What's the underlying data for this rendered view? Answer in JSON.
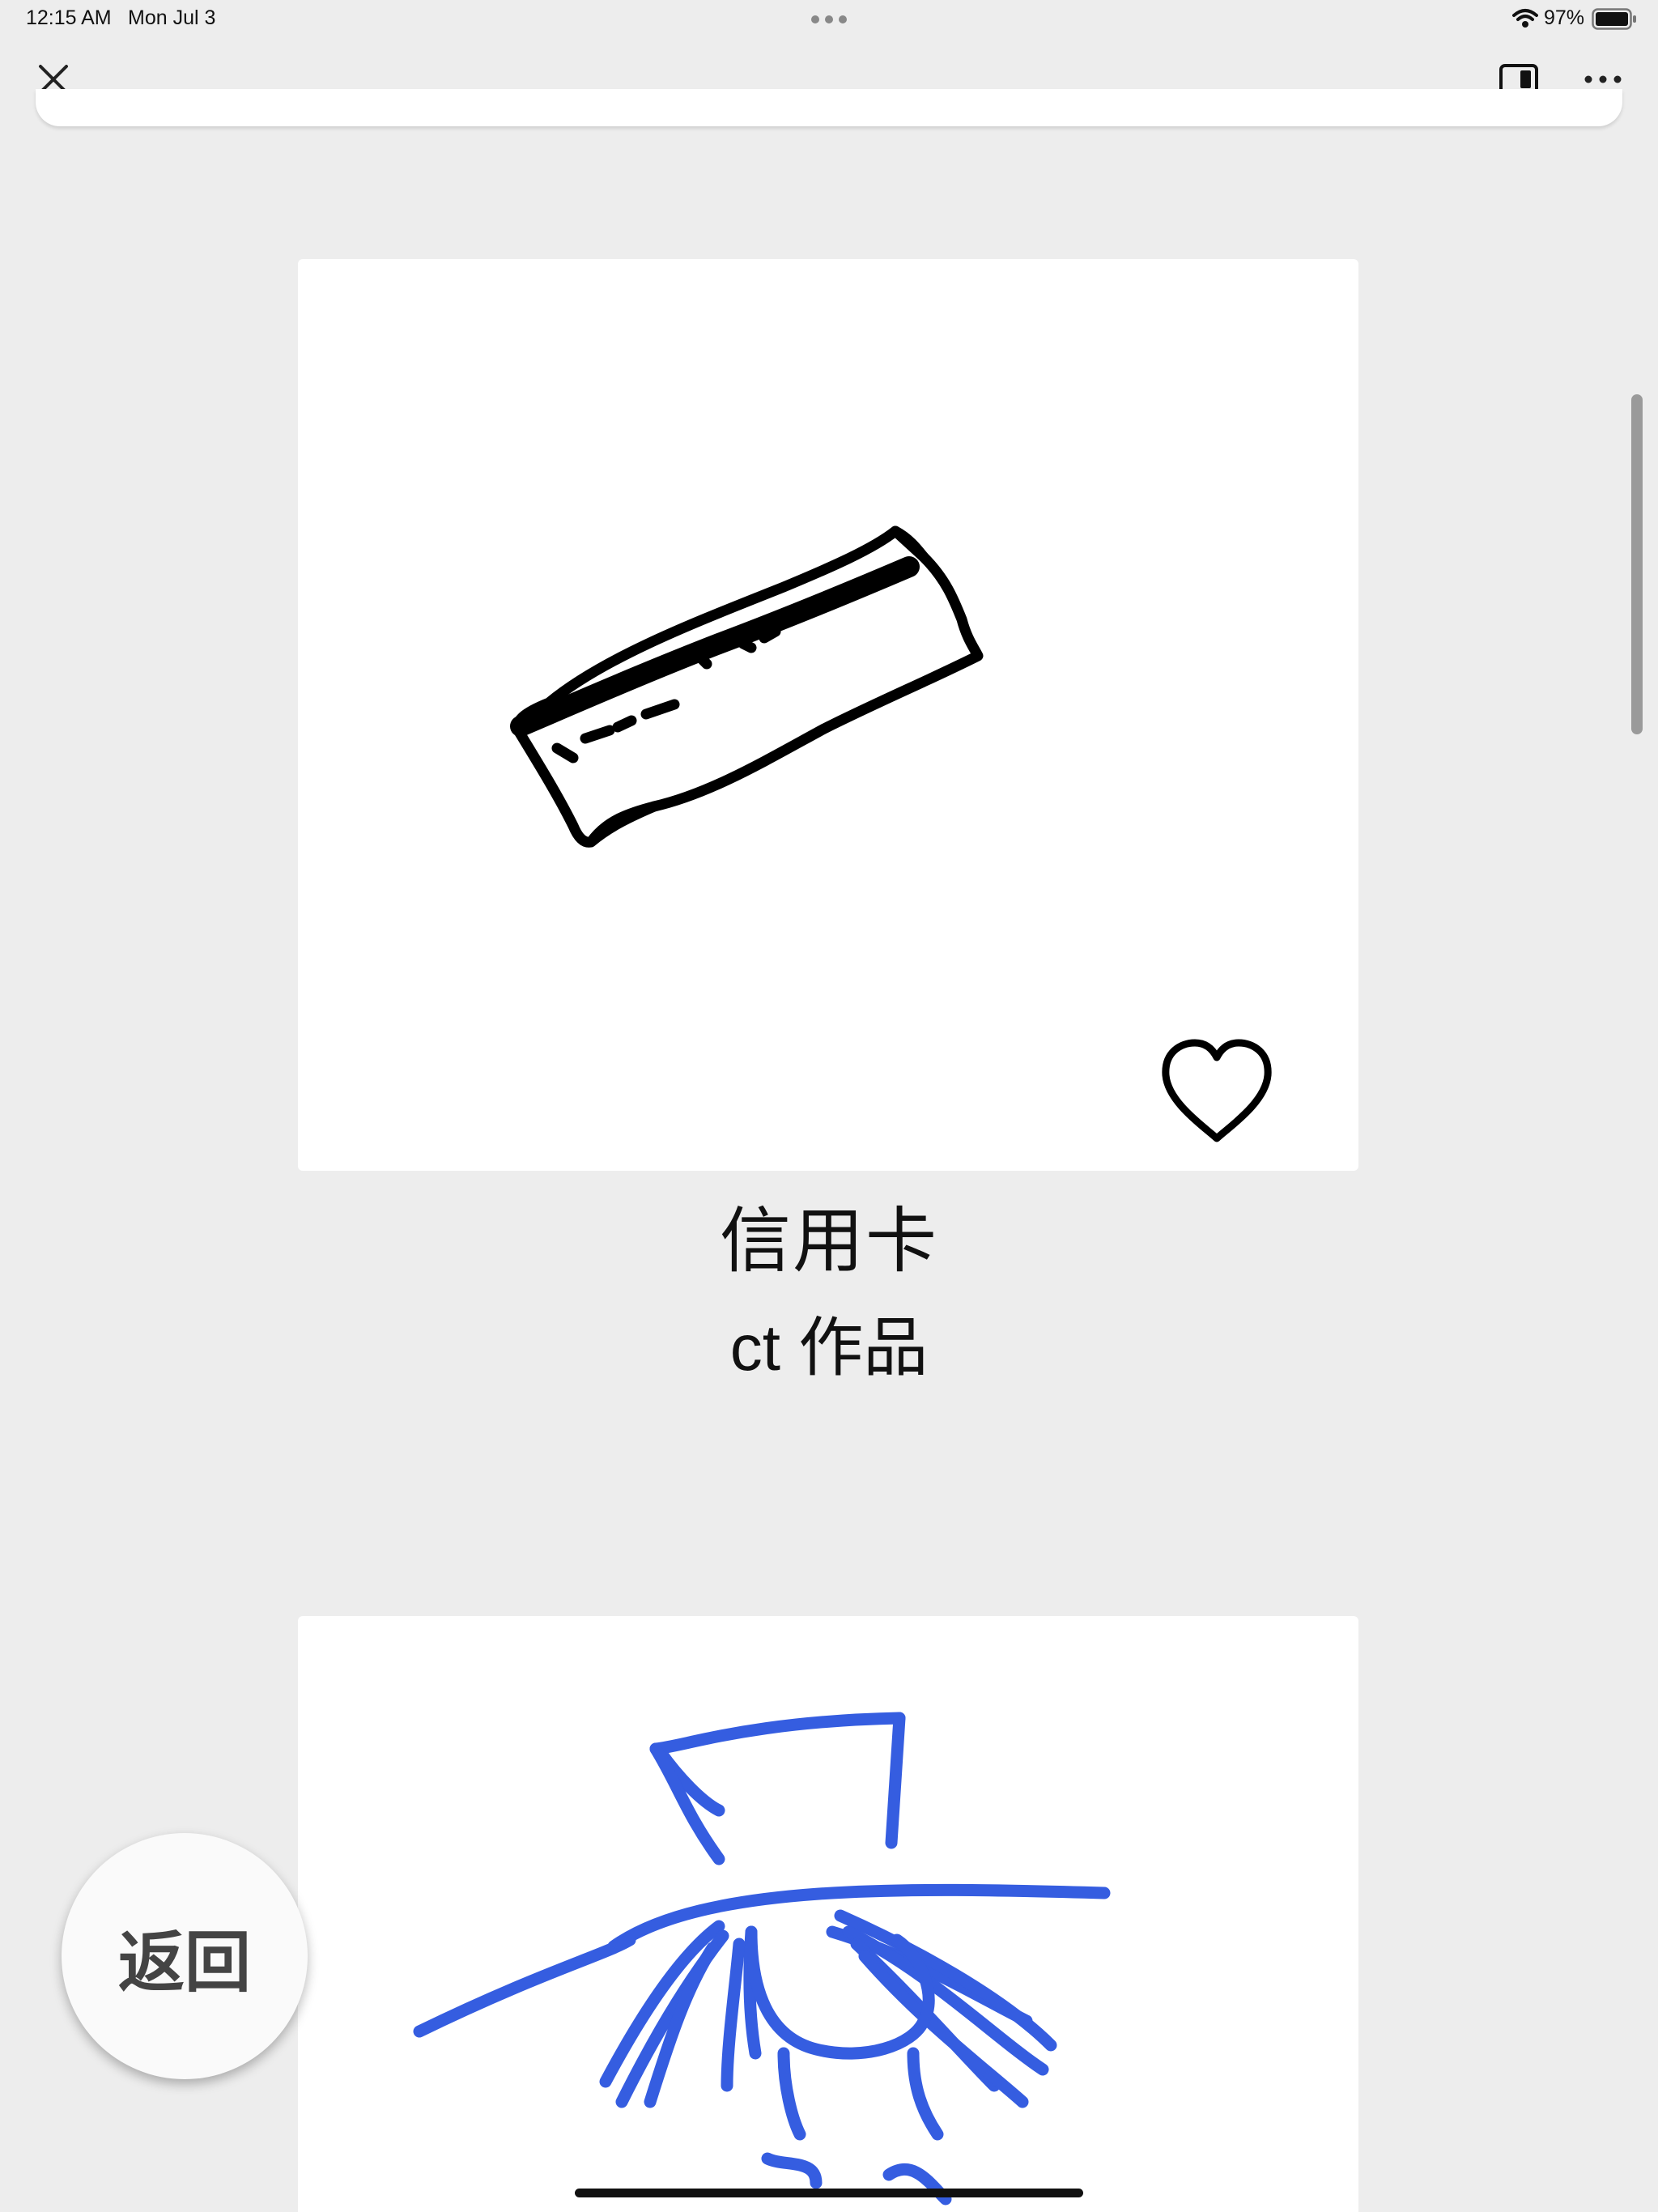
{
  "status_bar": {
    "time": "12:15 AM",
    "date": "Mon Jul 3",
    "battery_percent": "97%",
    "battery_level": 0.97
  },
  "nav_bar": {
    "close_icon": "close-icon",
    "split_view_icon": "sidebar-right-icon",
    "more_icon": "ellipsis-icon"
  },
  "artworks": [
    {
      "title": "信用卡",
      "author": "ct 作品",
      "drawing_icon": "credit-card-sketch",
      "stroke_color": "#000000",
      "liked": false
    },
    {
      "drawing_icon": "blue-figure-sketch",
      "stroke_color": "#355de0",
      "accent_color": "#f2c94c"
    }
  ],
  "back_button": {
    "label": "返回"
  },
  "colors": {
    "background": "#ededed",
    "card": "#ffffff"
  }
}
